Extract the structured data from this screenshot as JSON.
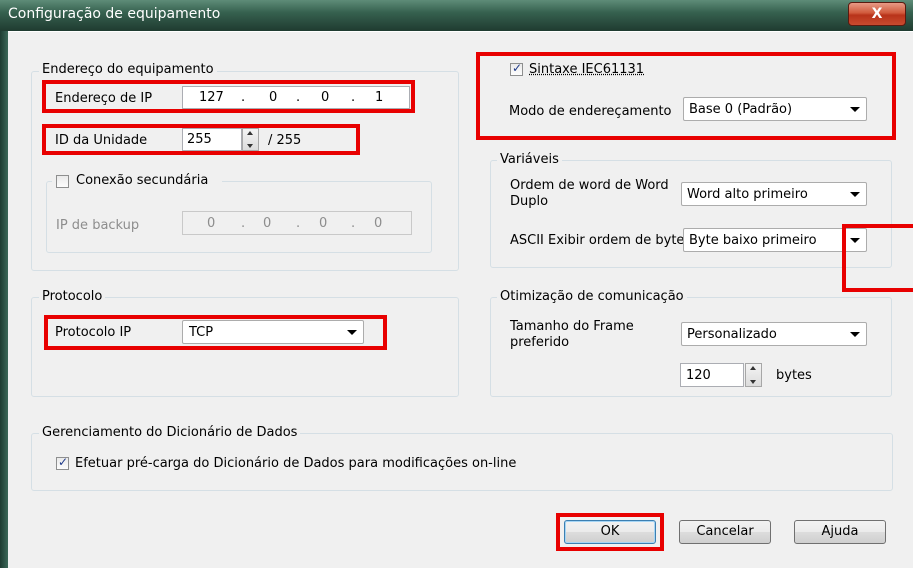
{
  "window": {
    "title": "Configuração de equipamento",
    "close_glyph": "X"
  },
  "device_address": {
    "group_label": "Endereço do equipamento",
    "ip_label": "Endereço de IP",
    "ip_octets": [
      "127",
      "0",
      "0",
      "1"
    ],
    "ip_separator": ".",
    "unit_id_label": "ID da Unidade",
    "unit_id_value": "255",
    "unit_id_max": "/ 255",
    "secondary_connection_label": "Conexão secundária",
    "secondary_connection_checked": false,
    "backup_ip_label": "IP de backup",
    "backup_ip_octets": [
      "0",
      "0",
      "0",
      "0"
    ]
  },
  "protocol": {
    "group_label": "Protocolo",
    "label": "Protocolo IP",
    "value": "TCP"
  },
  "iec": {
    "syntax_label": "Sintaxe IEC61131",
    "syntax_checked": true,
    "addressing_label": "Modo de endereçamento",
    "addressing_value": "Base 0 (Padrão)"
  },
  "variables": {
    "group_label": "Variáveis",
    "word_order_label_line1": "Ordem de word de Word",
    "word_order_label_line2": "Duplo",
    "word_order_value": "Word alto primeiro",
    "byte_order_label": "ASCII Exibir ordem de byte",
    "byte_order_value": "Byte baixo primeiro"
  },
  "comm_optimization": {
    "group_label": "Otimização de comunicação",
    "frame_size_label_line1": "Tamanho do Frame",
    "frame_size_label_line2": "preferido",
    "frame_size_value": "Personalizado",
    "bytes_value": "120",
    "bytes_unit": "bytes"
  },
  "data_dictionary": {
    "group_label": "Gerenciamento do Dicionário de Dados",
    "preload_label": "Efetuar pré-carga do Dicionário de Dados para modificações on-line",
    "preload_checked": true
  },
  "buttons": {
    "ok": "OK",
    "cancel": "Cancelar",
    "help": "Ajuda"
  },
  "colors": {
    "highlight": "#e80000",
    "titlebar": "#36614f",
    "close_button": "#c94b2f"
  }
}
